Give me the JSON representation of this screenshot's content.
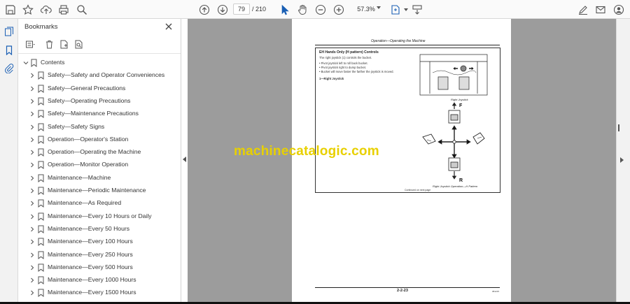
{
  "toolbar": {
    "current_page": "79",
    "total_pages": "/ 210",
    "zoom": "57.3%"
  },
  "bookmarks": {
    "title": "Bookmarks",
    "root": "Contents",
    "items": [
      {
        "label": "Safety—Safety and Operator Conveniences"
      },
      {
        "label": "Safety—General Precautions"
      },
      {
        "label": "Safety—Operating Precautions"
      },
      {
        "label": "Safety—Maintenance Precautions"
      },
      {
        "label": "Safety—Safety Signs"
      },
      {
        "label": "Operation—Operator's Station"
      },
      {
        "label": "Operation—Operating the Machine"
      },
      {
        "label": "Operation—Monitor Operation"
      },
      {
        "label": "Maintenance—Machine"
      },
      {
        "label": "Maintenance—Periodic Maintenance"
      },
      {
        "label": "Maintenance—As Required"
      },
      {
        "label": "Maintenance—Every 10 Hours or Daily"
      },
      {
        "label": "Maintenance—Every 50 Hours"
      },
      {
        "label": "Maintenance—Every 100 Hours"
      },
      {
        "label": "Maintenance—Every 250 Hours"
      },
      {
        "label": "Maintenance—Every 500 Hours"
      },
      {
        "label": "Maintenance—Every 1000 Hours"
      },
      {
        "label": "Maintenance—Every 1500 Hours"
      }
    ]
  },
  "document": {
    "header": "Operation—Operating the Machine",
    "section_title": "EH Hands Only (H pattern) Controls",
    "lines": [
      "The right joystick (1) controls the bucket.",
      "• Pivot joystick left to roll back bucket.",
      "• Pivot joystick right to dump bucket.",
      "• Bucket will move faster the farther the joystick is moved."
    ],
    "callout": "1—Right Joystick",
    "caption_top": "Right Joystick",
    "label_f": "F",
    "label_r": "R",
    "caption_bottom": "Right Joystick Operation—H Pattern",
    "continued": "Continued on next page",
    "page_number": "2-2-23",
    "footer_code": "081215"
  },
  "watermark": "machinecatalogic.com",
  "colors": {
    "watermark": "#e8d000",
    "toolbar_bg": "#fafafa",
    "doc_gray": "#9c9c9c"
  }
}
